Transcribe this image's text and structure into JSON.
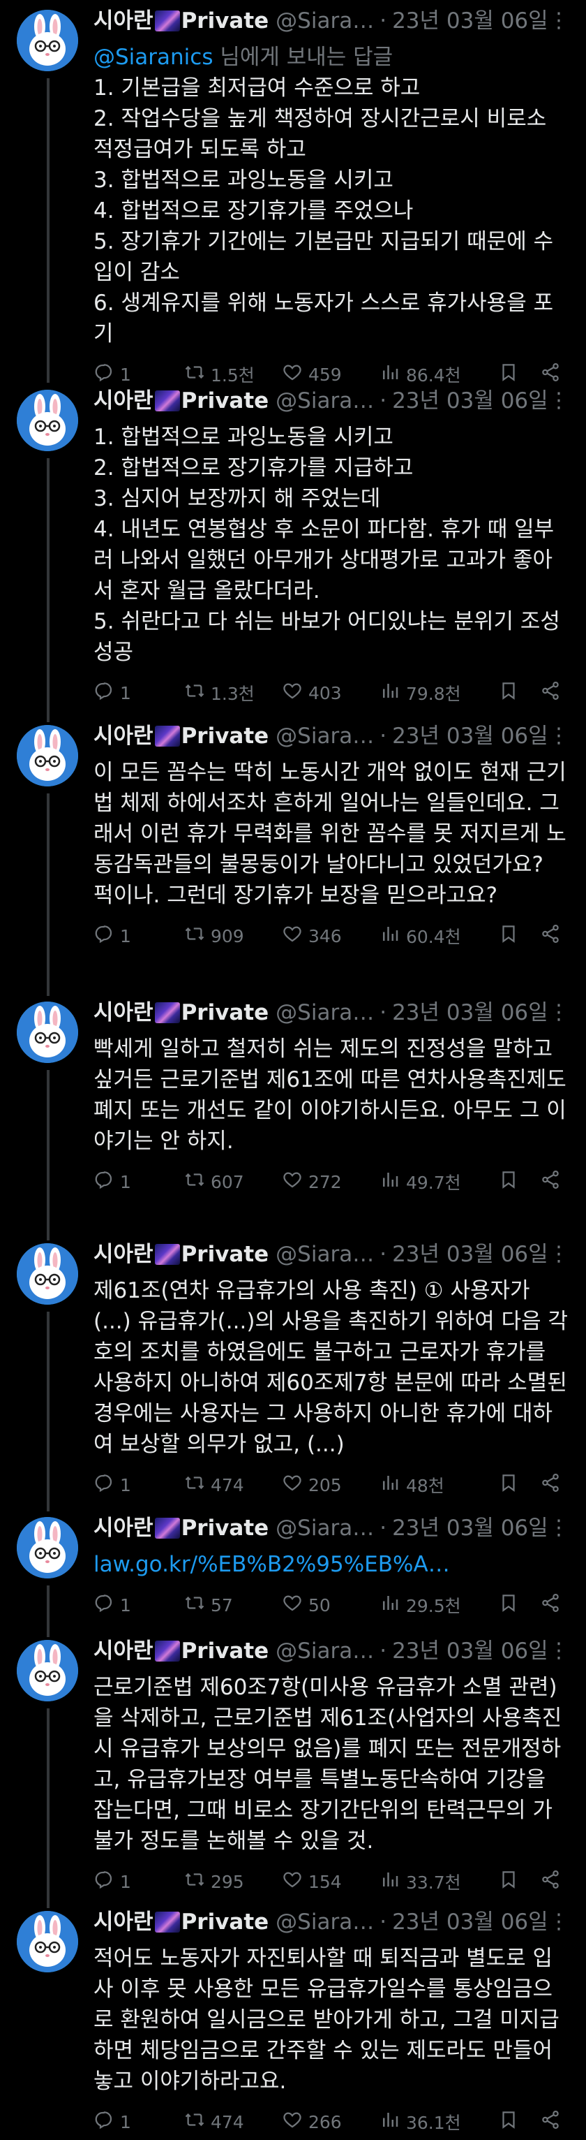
{
  "author": {
    "name": "시아란",
    "name_suffix": "Private",
    "handle": "@Siara…",
    "separator": "·",
    "date": "23년 03월 06일",
    "avatar_icon": "bunny-avatar-icon"
  },
  "reply_context": {
    "mention": "@Siaranics",
    "suffix": " 님에게 보내는 답글"
  },
  "tweets": [
    {
      "text": "1. 기본급을 최저급여 수준으로 하고\n2. 작업수당을 높게 책정하여 장시간근로시 비로소 적정급여가 되도록 하고\n3. 합법적으로 과잉노동을 시키고\n4. 합법적으로 장기휴가를 주었으나\n5. 장기휴가 기간에는 기본급만 지급되기 때문에 수입이 감소\n6. 생계유지를 위해 노동자가 스스로 휴가사용을 포기",
      "replies": "1",
      "retweets": "1.5천",
      "likes": "459",
      "views": "86.4천"
    },
    {
      "text": "1. 합법적으로 과잉노동을 시키고\n2. 합법적으로 장기휴가를 지급하고\n3. 심지어 보장까지 해 주었는데\n4. 내년도 연봉협상 후 소문이 파다함. 휴가 때 일부러 나와서 일했던 아무개가 상대평가로 고과가 좋아서 혼자 월급 올랐다더라.\n5. 쉬란다고 다 쉬는 바보가 어디있냐는 분위기 조성 성공",
      "replies": "1",
      "retweets": "1.3천",
      "likes": "403",
      "views": "79.8천"
    },
    {
      "text": "이 모든 꼼수는 딱히 노동시간 개악 없이도 현재 근기법 체제 하에서조차 흔하게 일어나는 일들인데요. 그래서 이런 휴가 무력화를 위한 꼼수를 못 저지르게 노동감독관들의 불몽둥이가 날아다니고 있었던가요? 퍽이나. 그런데 장기휴가 보장을 믿으라고요?",
      "replies": "1",
      "retweets": "909",
      "likes": "346",
      "views": "60.4천"
    },
    {
      "text": "빡세게 일하고 철저히 쉬는 제도의 진정성을 말하고 싶거든 근로기준법 제61조에 따른 연차사용촉진제도 폐지 또는 개선도 같이 이야기하시든요. 아무도 그 이야기는 안 하지.",
      "replies": "1",
      "retweets": "607",
      "likes": "272",
      "views": "49.7천"
    },
    {
      "text": "제61조(연차 유급휴가의 사용 촉진) ① 사용자가 (...) 유급휴가(...)의 사용을 촉진하기 위하여 다음 각 호의 조치를 하였음에도 불구하고 근로자가 휴가를 사용하지 아니하여 제60조제7항 본문에 따라 소멸된 경우에는 사용자는 그 사용하지 아니한 휴가에 대하여 보상할 의무가 없고, (...)",
      "replies": "1",
      "retweets": "474",
      "likes": "205",
      "views": "48천"
    },
    {
      "link": "law.go.kr/%EB%B2%95%EB%A…",
      "replies": "1",
      "retweets": "57",
      "likes": "50",
      "views": "29.5천"
    },
    {
      "text": "근로기준법 제60조7항(미사용 유급휴가 소멸 관련)을 삭제하고, 근로기준법 제61조(사업자의 사용촉진시 유급휴가 보상의무 없음)를 폐지 또는 전문개정하고, 유급휴가보장 여부를 특별노동단속하여 기강을 잡는다면, 그때 비로소 장기간단위의 탄력근무의 가불가 정도를 논해볼 수 있을 것.",
      "replies": "1",
      "retweets": "295",
      "likes": "154",
      "views": "33.7천"
    },
    {
      "text": "적어도 노동자가 자진퇴사할 때 퇴직금과 별도로 입사 이후 못 사용한 모든 유급휴가일수를 통상임금으로 환원하여 일시금으로 받아가게 하고, 그걸 미지급하면 체당임금으로 간주할 수 있는 제도라도 만들어 놓고 이야기하라고요.",
      "replies": "1",
      "retweets": "474",
      "likes": "266",
      "views": "36.1천"
    }
  ],
  "colors": {
    "background": "#000000",
    "text": "#e7e9ea",
    "muted": "#71767b",
    "accent": "#1d9bf0",
    "thread_line": "#333639"
  }
}
